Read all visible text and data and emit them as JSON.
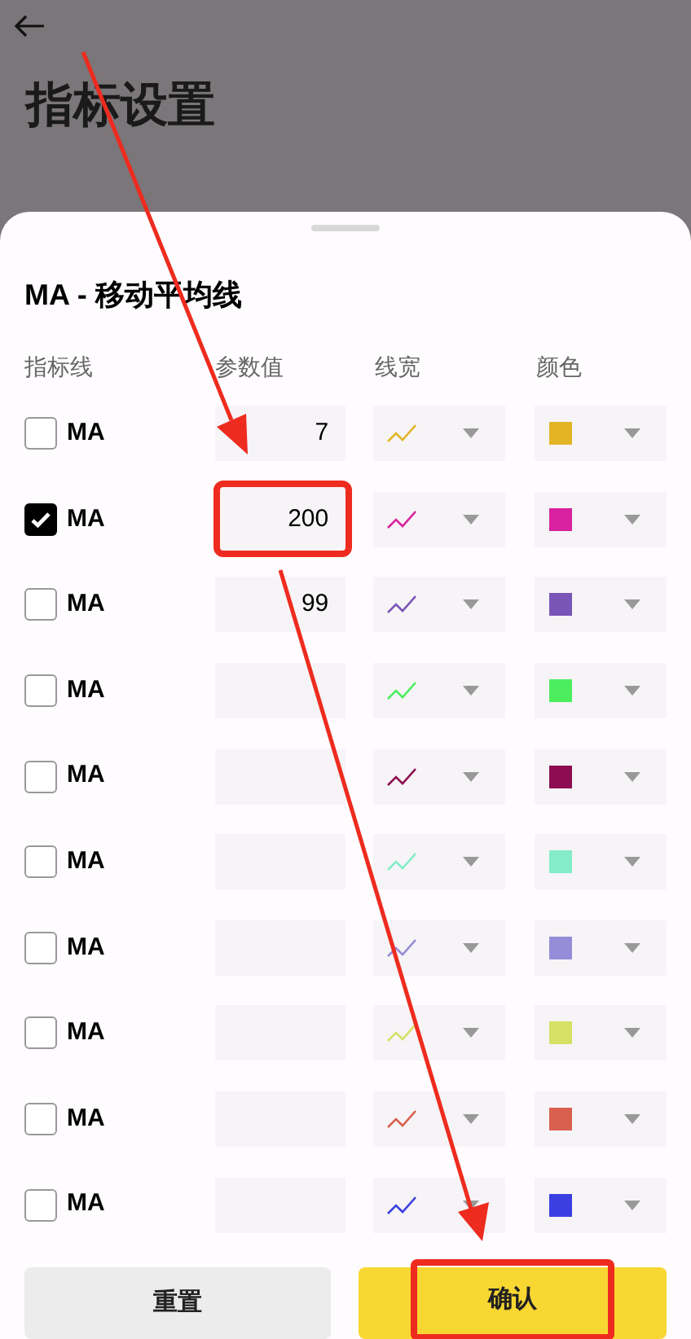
{
  "page": {
    "title": "指标设置"
  },
  "sheet": {
    "title": "MA - 移动平均线",
    "columns": [
      "指标线",
      "参数值",
      "线宽",
      "颜色"
    ],
    "rows": [
      {
        "checked": false,
        "name": "MA",
        "value": "7",
        "highlighted": false,
        "color": "#e3b526"
      },
      {
        "checked": true,
        "name": "MA",
        "value": "200",
        "highlighted": true,
        "color": "#d9229f"
      },
      {
        "checked": false,
        "name": "MA",
        "value": "99",
        "highlighted": false,
        "color": "#7a55b8"
      },
      {
        "checked": false,
        "name": "MA",
        "highlighted": false,
        "color": "#4ced5e"
      },
      {
        "checked": false,
        "name": "MA",
        "highlighted": false,
        "color": "#8c0d52"
      },
      {
        "checked": false,
        "name": "MA",
        "highlighted": false,
        "color": "#84ecc9"
      },
      {
        "checked": false,
        "name": "MA",
        "highlighted": false,
        "color": "#958dd8"
      },
      {
        "checked": false,
        "name": "MA",
        "highlighted": false,
        "color": "#d5e065"
      },
      {
        "checked": false,
        "name": "MA",
        "highlighted": false,
        "color": "#d9604f"
      },
      {
        "checked": false,
        "name": "MA",
        "highlighted": false,
        "color": "#3b3fe2"
      }
    ],
    "reset": {
      "label": "重置"
    },
    "confirm": {
      "label": "确认",
      "highlighted": true
    }
  }
}
